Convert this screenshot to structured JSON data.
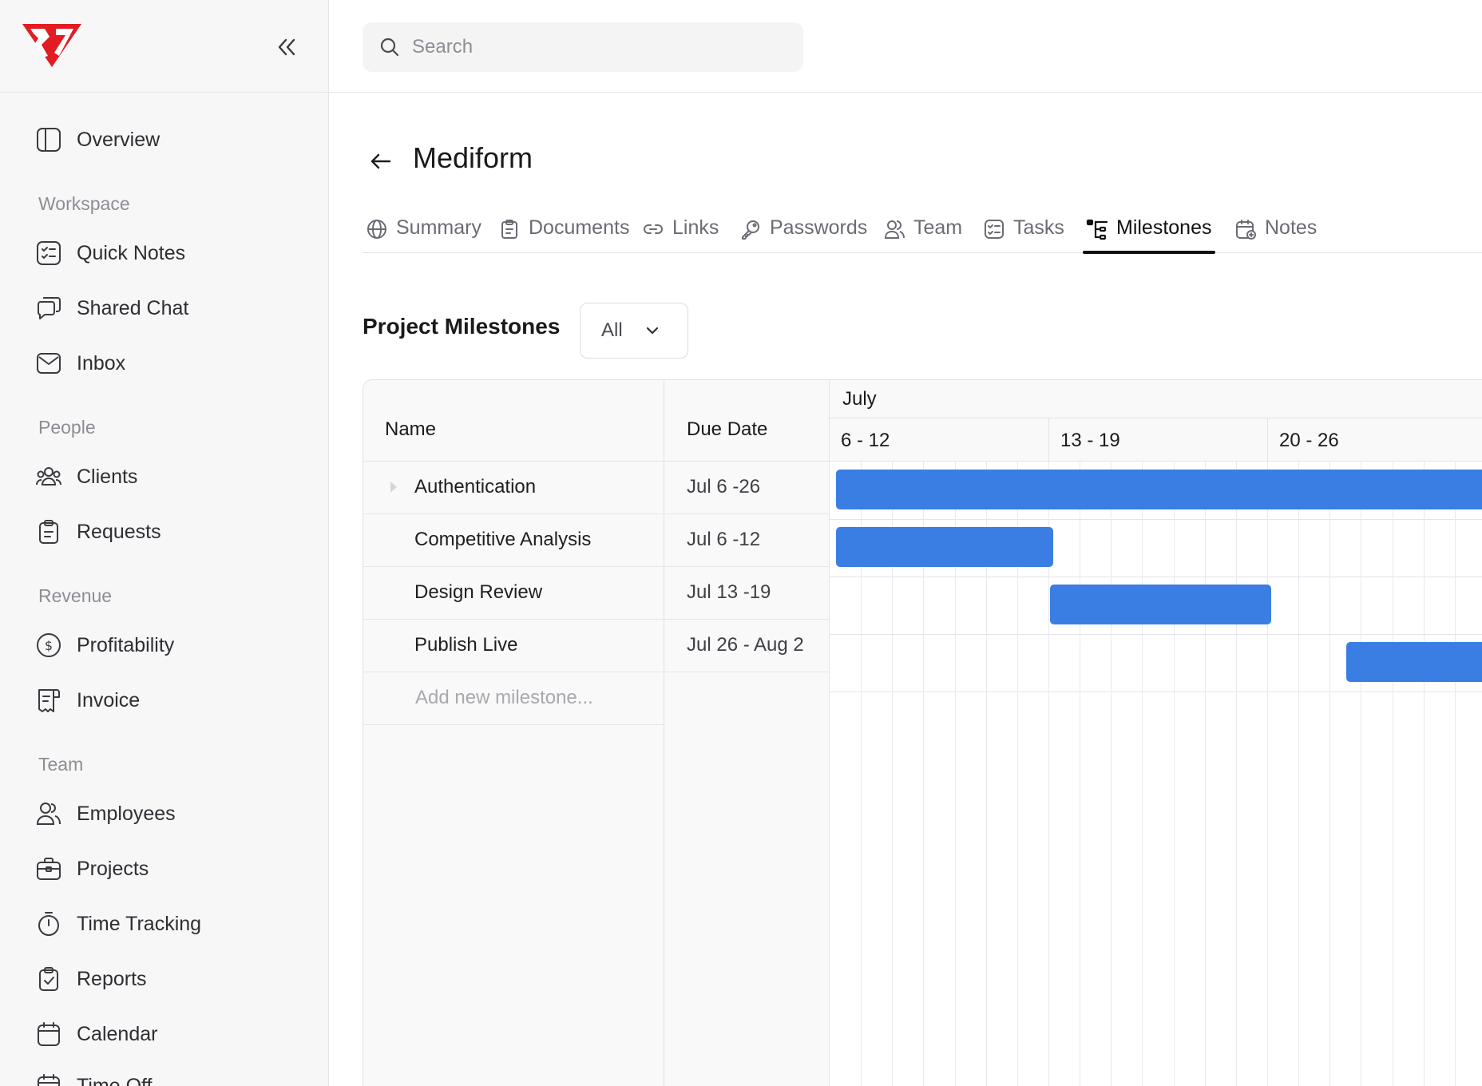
{
  "sidebar": {
    "nav": {
      "overview": "Overview",
      "workspace_title": "Workspace",
      "quick_notes": "Quick Notes",
      "shared_chat": "Shared Chat",
      "inbox": "Inbox",
      "people_title": "People",
      "clients": "Clients",
      "requests": "Requests",
      "revenue_title": "Revenue",
      "profitability": "Profitability",
      "invoice": "Invoice",
      "team_title": "Team",
      "employees": "Employees",
      "projects": "Projects",
      "time_tracking": "Time Tracking",
      "reports": "Reports",
      "calendar": "Calendar",
      "time_off": "Time Off"
    }
  },
  "topbar": {
    "search_placeholder": "Search"
  },
  "page": {
    "title": "Mediform",
    "tabs": [
      {
        "label": "Summary",
        "icon": "globe-icon"
      },
      {
        "label": "Documents",
        "icon": "clipboard-icon"
      },
      {
        "label": "Links",
        "icon": "link-icon"
      },
      {
        "label": "Passwords",
        "icon": "key-icon"
      },
      {
        "label": "Team",
        "icon": "users-icon"
      },
      {
        "label": "Tasks",
        "icon": "checklist-icon"
      },
      {
        "label": "Milestones",
        "icon": "milestones-icon",
        "active": true
      },
      {
        "label": "Notes",
        "icon": "calendar-note-icon"
      }
    ]
  },
  "milestones": {
    "section_title": "Project Milestones",
    "filter_value": "All",
    "columns": {
      "name": "Name",
      "due": "Due Date"
    },
    "month": "July",
    "weeks": [
      "6 - 12",
      "13 - 19",
      "20 - 26"
    ],
    "rows": [
      {
        "name": "Authentication",
        "due": "Jul 6 -26"
      },
      {
        "name": "Competitive Analysis",
        "due": "Jul 6 -12"
      },
      {
        "name": "Design Review",
        "due": "Jul 13 -19"
      },
      {
        "name": "Publish Live",
        "due": "Jul 26 - Aug 2"
      }
    ],
    "add_placeholder": "Add new milestone...",
    "bar_color": "#3a7ee4"
  }
}
